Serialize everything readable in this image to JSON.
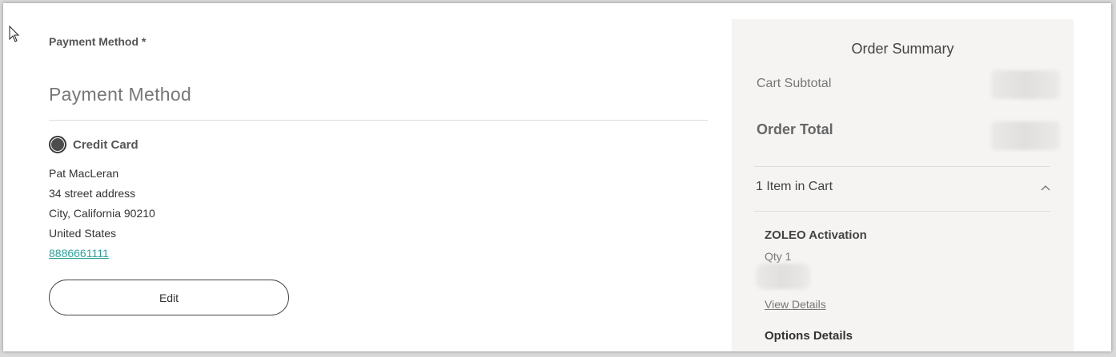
{
  "payment": {
    "required_label": "Payment Method *",
    "heading": "Payment Method",
    "option_label": "Credit Card",
    "selected": true,
    "address": {
      "name": "Pat MacLeran",
      "street": "34 street address",
      "city_line": "City, California 90210",
      "country": "United States",
      "phone": "8886661111"
    },
    "edit_label": "Edit"
  },
  "summary": {
    "title": "Order Summary",
    "subtotal_label": "Cart Subtotal",
    "total_label": "Order Total",
    "cart_count_label": "1 Item in Cart",
    "item": {
      "name": "ZOLEO Activation",
      "qty": "Qty 1",
      "view_details": "View Details",
      "options_title": "Options Details"
    }
  },
  "icons": {
    "cursor": "mouse-pointer-icon",
    "chevron": "chevron-up-icon"
  },
  "colors": {
    "accent_link": "#2ea39a",
    "summary_bg": "#f5f4f2"
  }
}
